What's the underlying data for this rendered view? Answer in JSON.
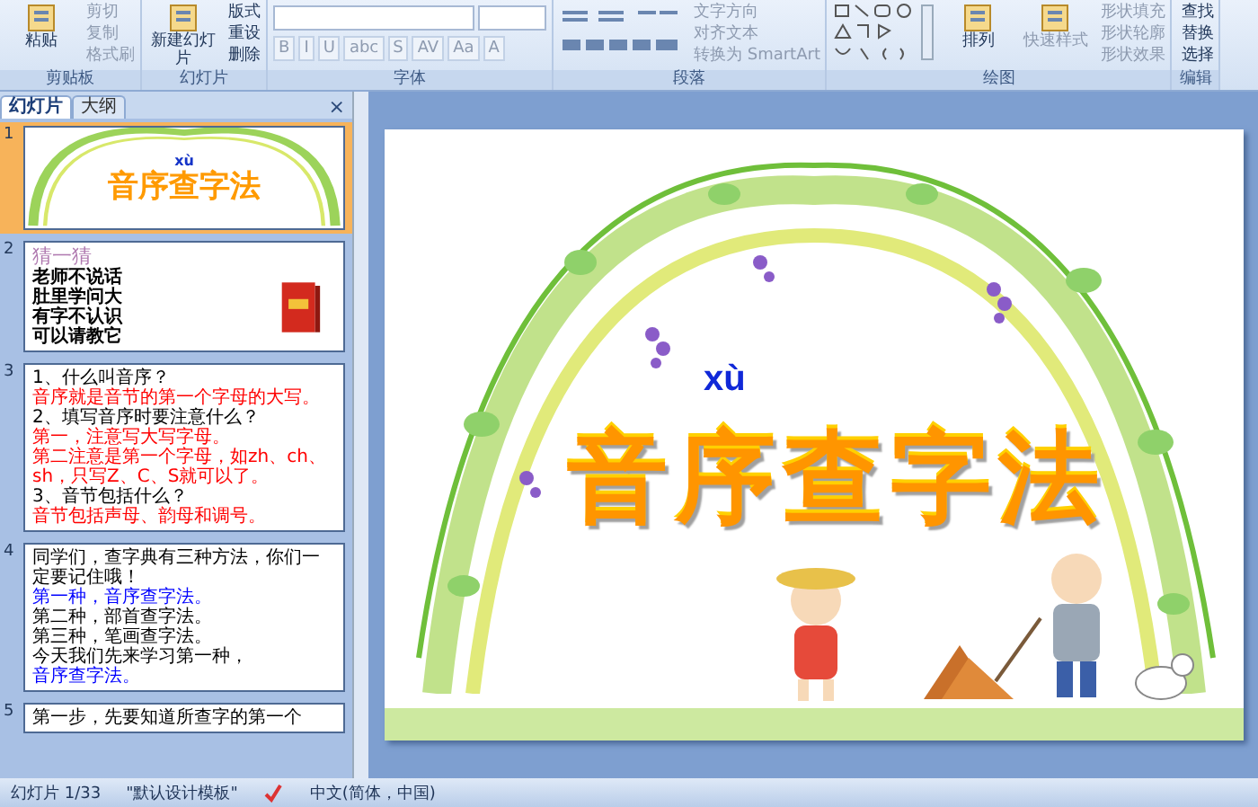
{
  "ribbon": {
    "groups": [
      {
        "kind": "clipboard",
        "label": "剪贴板",
        "large": [
          {
            "label": "粘贴",
            "disabled": false
          }
        ],
        "small": [
          {
            "label": "剪切",
            "disabled": true
          },
          {
            "label": "复制",
            "disabled": true
          },
          {
            "label": "格式刷",
            "disabled": true
          }
        ]
      },
      {
        "kind": "slides",
        "label": "幻灯片",
        "large": [
          {
            "label": "新建幻灯片",
            "disabled": false
          }
        ],
        "small": [
          {
            "label": "版式",
            "disabled": false
          },
          {
            "label": "重设",
            "disabled": false
          },
          {
            "label": "删除",
            "disabled": false
          }
        ]
      },
      {
        "kind": "font",
        "label": "字体",
        "small": [
          {
            "label": "B",
            "disabled": true
          },
          {
            "label": "I",
            "disabled": true
          },
          {
            "label": "U",
            "disabled": true
          },
          {
            "label": "abc",
            "disabled": true
          },
          {
            "label": "S",
            "disabled": true
          },
          {
            "label": "AV",
            "disabled": true
          },
          {
            "label": "Aa",
            "disabled": true
          },
          {
            "label": "A",
            "disabled": true
          }
        ]
      },
      {
        "kind": "paragraph",
        "label": "段落",
        "small": [
          {
            "label": "文字方向",
            "disabled": true
          },
          {
            "label": "对齐文本",
            "disabled": true
          },
          {
            "label": "转换为 SmartArt",
            "disabled": true
          }
        ]
      },
      {
        "kind": "drawing",
        "label": "绘图",
        "large": [
          {
            "label": "排列",
            "disabled": false
          },
          {
            "label": "快速样式",
            "disabled": true
          }
        ],
        "small": [
          {
            "label": "形状填充",
            "disabled": true
          },
          {
            "label": "形状轮廓",
            "disabled": true
          },
          {
            "label": "形状效果",
            "disabled": true
          }
        ]
      },
      {
        "kind": "editing",
        "label": "编辑",
        "small": [
          {
            "label": "查找",
            "disabled": false
          },
          {
            "label": "替换",
            "disabled": false
          },
          {
            "label": "选择",
            "disabled": false
          }
        ]
      }
    ]
  },
  "panel": {
    "tabs": [
      {
        "label": "幻灯片",
        "selected": true
      },
      {
        "label": "大纲",
        "selected": false
      }
    ],
    "close": "×"
  },
  "slides": [
    {
      "number": "1",
      "selected": true,
      "kind": "title",
      "pinyin": "xù",
      "title": "音序查字法"
    },
    {
      "number": "2",
      "selected": false,
      "kind": "riddle",
      "heading": "猜一猜",
      "lines": [
        "老师不说话",
        "肚里学问大",
        "有字不认识",
        "可以请教它"
      ]
    },
    {
      "number": "3",
      "selected": false,
      "kind": "text",
      "paragraphs": [
        {
          "text": "1、什么叫音序？",
          "color": "#000000"
        },
        {
          "text": "音序就是音节的第一个字母的大写。",
          "color": "#ff0000"
        },
        {
          "text": "2、填写音序时要注意什么？",
          "color": "#000000"
        },
        {
          "text": "第一，注意写大写字母。",
          "color": "#ff0000"
        },
        {
          "text": "第二注意是第一个字母，如zh、ch、sh，只写Z、C、S就可以了。",
          "color": "#ff0000"
        },
        {
          "text": "3、音节包括什么？",
          "color": "#000000"
        },
        {
          "text": "音节包括声母、韵母和调号。",
          "color": "#ff0000"
        }
      ]
    },
    {
      "number": "4",
      "selected": false,
      "kind": "text",
      "paragraphs": [
        {
          "text": "同学们，查字典有三种方法，你们一定要记住哦！",
          "color": "#000000"
        },
        {
          "text": "第一种，音序查字法。",
          "color": "#0000ff"
        },
        {
          "text": "第二种，部首查字法。",
          "color": "#000000"
        },
        {
          "text": "第三种，笔画查字法。",
          "color": "#000000"
        },
        {
          "text": "今天我们先来学习第一种，",
          "color": "#000000"
        },
        {
          "text": "音序查字法。",
          "color": "#0000ff"
        }
      ]
    },
    {
      "number": "5",
      "selected": false,
      "kind": "text",
      "paragraphs": [
        {
          "text": "第一步，先要知道所查字的第一个",
          "color": "#000000"
        }
      ]
    }
  ],
  "slide": {
    "pinyin": "xù",
    "title": "音序查字法"
  },
  "status_bar": {
    "slide_count": "幻灯片 1/33",
    "theme": "\"默认设计模板\"",
    "language": "中文(简体，中国)"
  }
}
